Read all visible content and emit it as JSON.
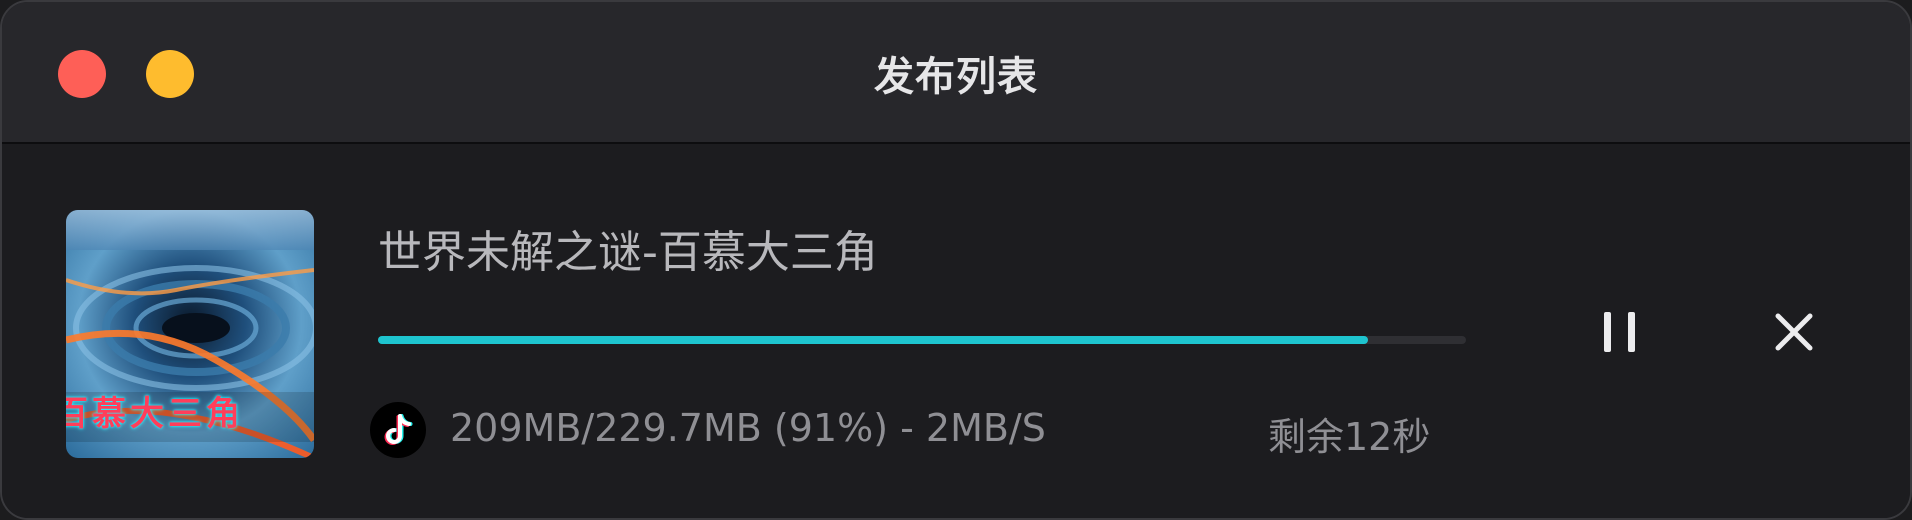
{
  "window": {
    "title": "发布列表"
  },
  "item": {
    "title": "世界未解之谜-百慕大三角",
    "thumbnail_caption": "百慕大三角",
    "progress_percent": 91,
    "stats": "209MB/229.7MB (91%) - 2MB/S",
    "remaining": "剩余12秒",
    "platform_icon": "tiktok-icon"
  },
  "colors": {
    "accent": "#1ec4cf",
    "close_light": "#fe5f57",
    "minimize_light": "#febc2e"
  },
  "icons": {
    "pause": "pause-icon",
    "cancel": "close-icon"
  }
}
